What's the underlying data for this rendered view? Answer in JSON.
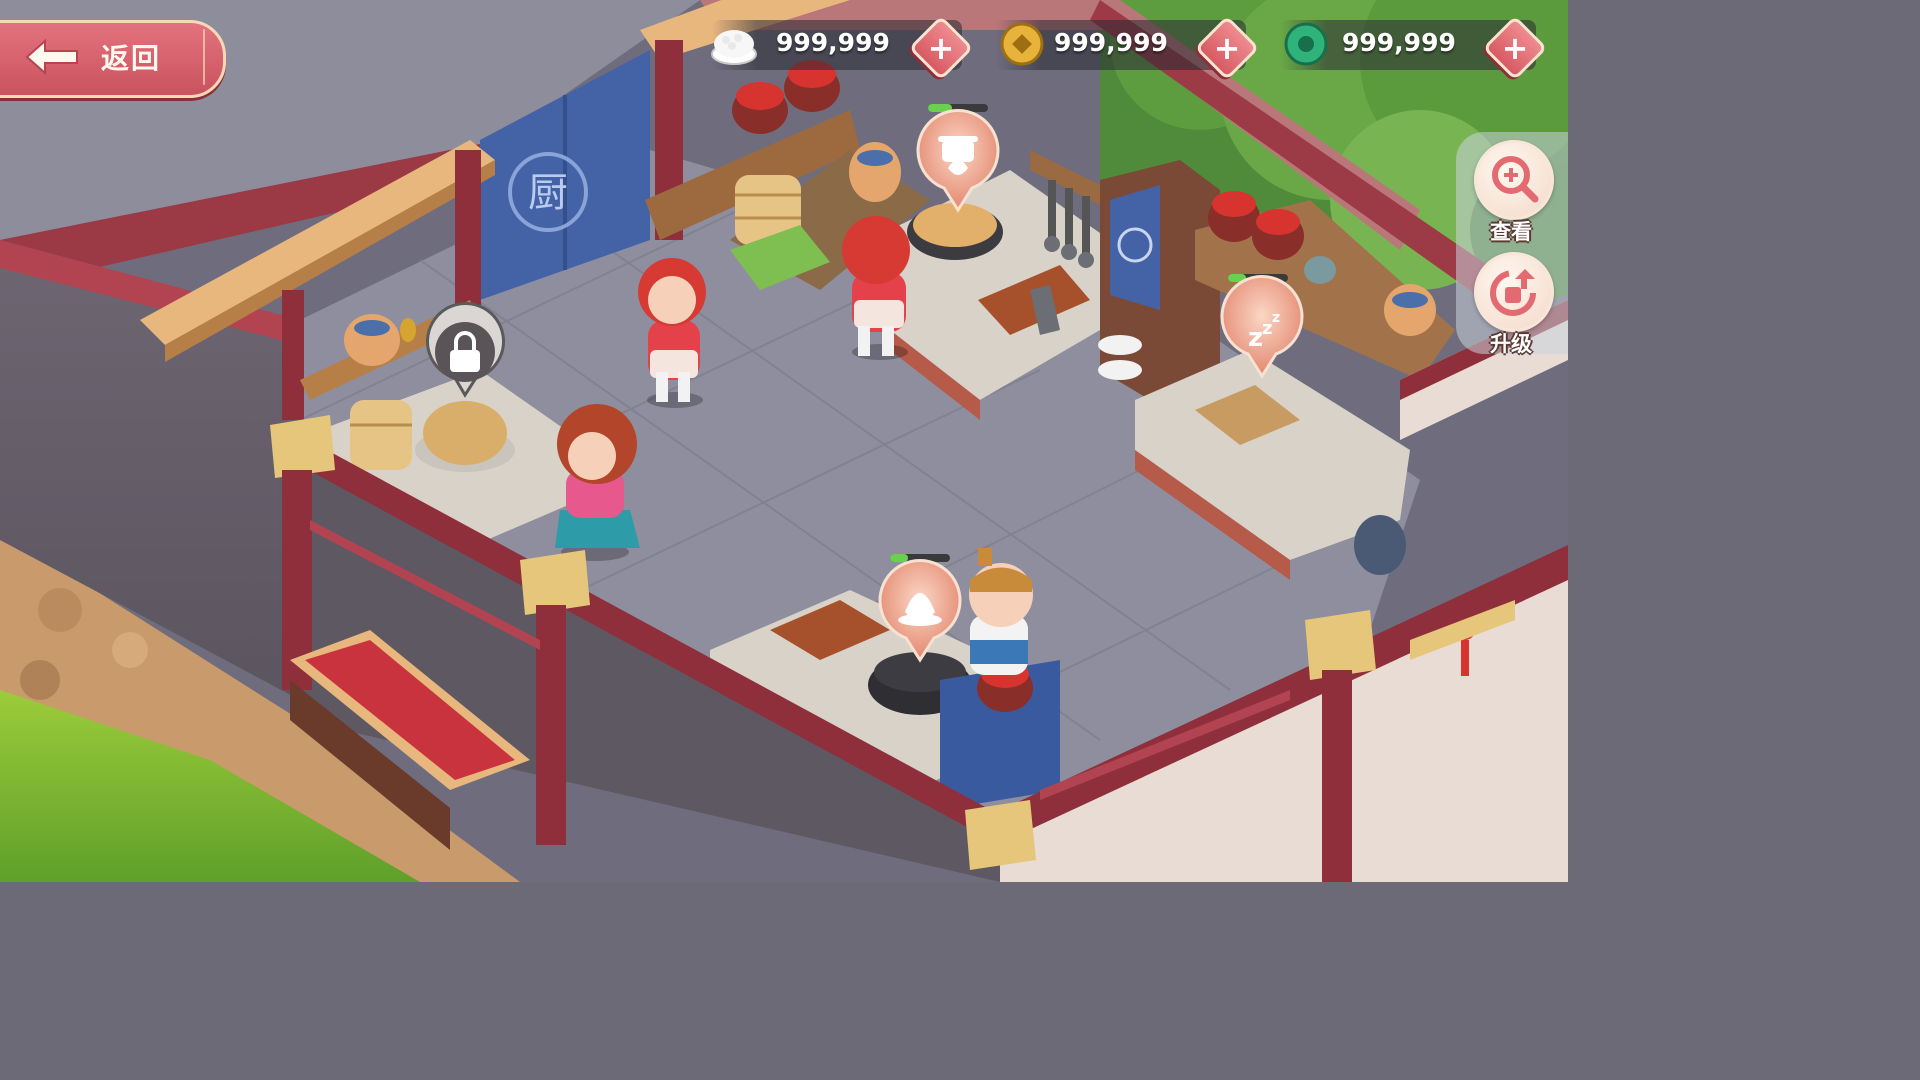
{
  "hud": {
    "back_label": "返回",
    "currencies": [
      {
        "name": "rice-icon",
        "value": "999,999"
      },
      {
        "name": "coin-icon",
        "value": "999,999"
      },
      {
        "name": "jade-icon",
        "value": "999,999"
      }
    ],
    "add_symbol": "+"
  },
  "side_menu": {
    "view_label": "查看",
    "upgrade_label": "升级"
  },
  "scene": {
    "banner_char": "厨",
    "station_status": [
      {
        "name": "locked-station-bubble",
        "icon": "lock-icon"
      },
      {
        "name": "steaming-bubble",
        "icon": "pot-fire-icon",
        "progress": 0.4
      },
      {
        "name": "sleeping-bubble",
        "icon": "zzz-icon",
        "progress": 0.3
      },
      {
        "name": "frying-bubble",
        "icon": "fire-icon",
        "progress": 0.3
      }
    ]
  },
  "colors": {
    "accent_red": "#c9535f",
    "wall_maroon": "#8e2f3b",
    "floor_gray": "#8f8e9e",
    "wood_light": "#e8b77e",
    "banner_blue": "#4363a6"
  }
}
